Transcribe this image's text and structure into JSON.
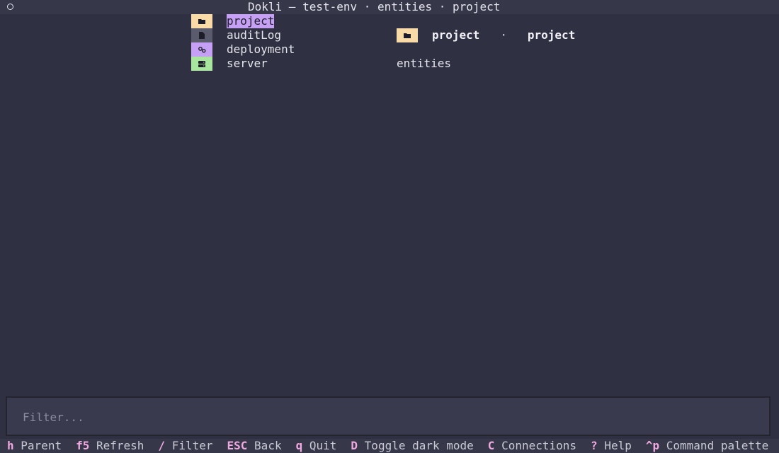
{
  "window": {
    "title": "Dokli — test-env · entities · project"
  },
  "entities": [
    {
      "label": "project",
      "icon": "folder-icon",
      "icon_bg": "#f9dba7",
      "selected": true
    },
    {
      "label": "auditLog",
      "icon": "file-icon",
      "icon_bg": "#5a5c6e",
      "selected": false
    },
    {
      "label": "deployment",
      "icon": "gears-icon",
      "icon_bg": "#c5a0f5",
      "selected": false
    },
    {
      "label": "server",
      "icon": "server-icon",
      "icon_bg": "#a8e6a0",
      "selected": false
    }
  ],
  "detail": {
    "name": "project",
    "separator": "·",
    "kind": "project",
    "parent": "entities"
  },
  "filter": {
    "placeholder": "Filter...",
    "value": ""
  },
  "footer": {
    "bindings": [
      {
        "key": "h",
        "desc": "Parent"
      },
      {
        "key": "f5",
        "desc": "Refresh"
      },
      {
        "key": "/",
        "desc": "Filter"
      },
      {
        "key": "ESC",
        "desc": "Back"
      },
      {
        "key": "q",
        "desc": "Quit"
      },
      {
        "key": "D",
        "desc": "Toggle dark mode"
      },
      {
        "key": "C",
        "desc": "Connections"
      },
      {
        "key": "?",
        "desc": "Help"
      },
      {
        "key": "^p",
        "desc": "Command palette"
      }
    ]
  },
  "colors": {
    "background": "#2f3041",
    "selection": "#c5a0f5",
    "key_accent": "#f0a8e0"
  }
}
